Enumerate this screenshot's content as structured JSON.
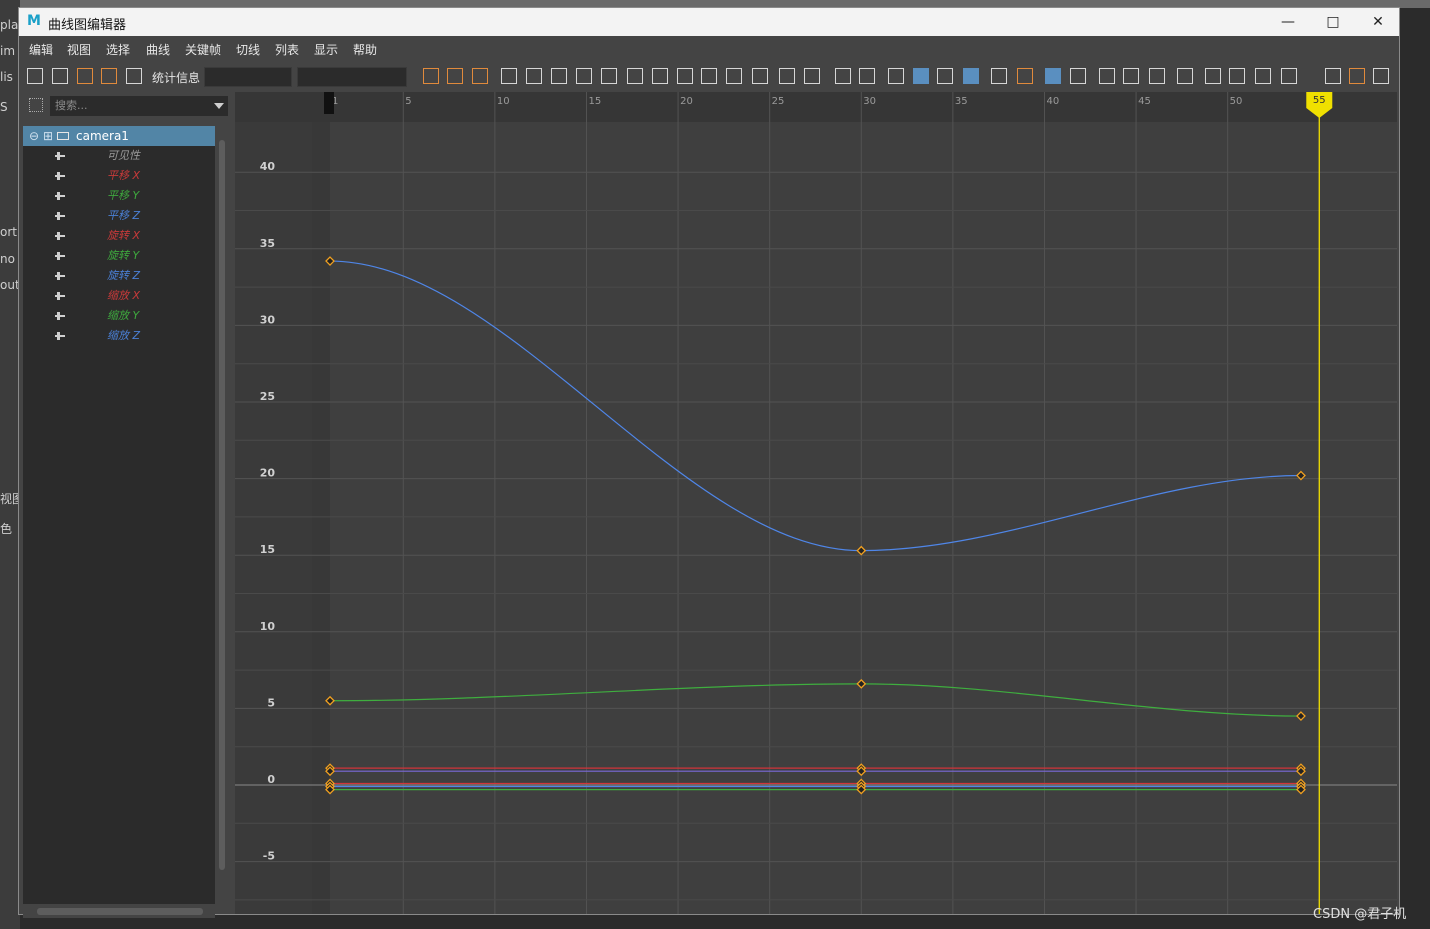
{
  "window": {
    "title": "曲线图编辑器",
    "logo": "M",
    "controls": [
      "minimize-icon",
      "maximize-icon",
      "close-icon"
    ]
  },
  "background": {
    "left_fragments": [
      "pla",
      "im",
      "lis",
      "S",
      "ort",
      "no",
      "out",
      "视图",
      "色"
    ],
    "watermark": "CSDN @君子机"
  },
  "menu": [
    "编辑",
    "视图",
    "选择",
    "曲线",
    "关键帧",
    "切线",
    "列表",
    "显示",
    "帮助"
  ],
  "toolbar": {
    "stats_label": "统计信息",
    "stat_value_1": "",
    "stat_value_2": ""
  },
  "outliner": {
    "search_placeholder": "搜索...",
    "node": "camera1",
    "channels": [
      {
        "label": "可见性",
        "color": "#9a9a9a"
      },
      {
        "label": "平移 X",
        "color": "#c83a3a"
      },
      {
        "label": "平移 Y",
        "color": "#3ea83e"
      },
      {
        "label": "平移 Z",
        "color": "#4a7fd4"
      },
      {
        "label": "旋转 X",
        "color": "#c83a3a"
      },
      {
        "label": "旋转 Y",
        "color": "#3ea83e"
      },
      {
        "label": "旋转 Z",
        "color": "#4a7fd4"
      },
      {
        "label": "缩放 X",
        "color": "#c83a3a"
      },
      {
        "label": "缩放 Y",
        "color": "#3ea83e"
      },
      {
        "label": "缩放 Z",
        "color": "#4a7fd4"
      }
    ]
  },
  "graph": {
    "time_ticks": [
      "1",
      "5",
      "10",
      "15",
      "20",
      "25",
      "30",
      "35",
      "40",
      "45",
      "50"
    ],
    "value_ticks": [
      "40",
      "35",
      "30",
      "25",
      "20",
      "15",
      "10",
      "5",
      "0",
      "-5"
    ],
    "current_frame": "55",
    "key_color": "#f0a020",
    "playhead_color": "#f0e000",
    "curves": [
      {
        "color": "#4f86e8",
        "keys": [
          [
            1,
            34.2
          ],
          [
            30,
            15.3
          ],
          [
            54,
            20.2
          ]
        ]
      },
      {
        "color": "#3fae3f",
        "keys": [
          [
            1,
            5.5
          ],
          [
            30,
            6.6
          ],
          [
            54,
            4.5
          ]
        ]
      },
      {
        "color": "#d0343a",
        "keys": [
          [
            1,
            1.1
          ],
          [
            30,
            1.1
          ],
          [
            54,
            1.1
          ]
        ]
      },
      {
        "color": "#7a6ad8",
        "keys": [
          [
            1,
            0.9
          ],
          [
            30,
            0.9
          ],
          [
            54,
            0.9
          ]
        ]
      },
      {
        "color": "#d0343a",
        "keys": [
          [
            1,
            0.1
          ],
          [
            30,
            0.1
          ],
          [
            54,
            0.1
          ]
        ]
      },
      {
        "color": "#4f86e8",
        "keys": [
          [
            1,
            -0.1
          ],
          [
            30,
            -0.1
          ],
          [
            54,
            -0.1
          ]
        ]
      },
      {
        "color": "#3fae3f",
        "keys": [
          [
            1,
            -0.3
          ],
          [
            30,
            -0.3
          ],
          [
            54,
            -0.3
          ]
        ]
      }
    ]
  }
}
